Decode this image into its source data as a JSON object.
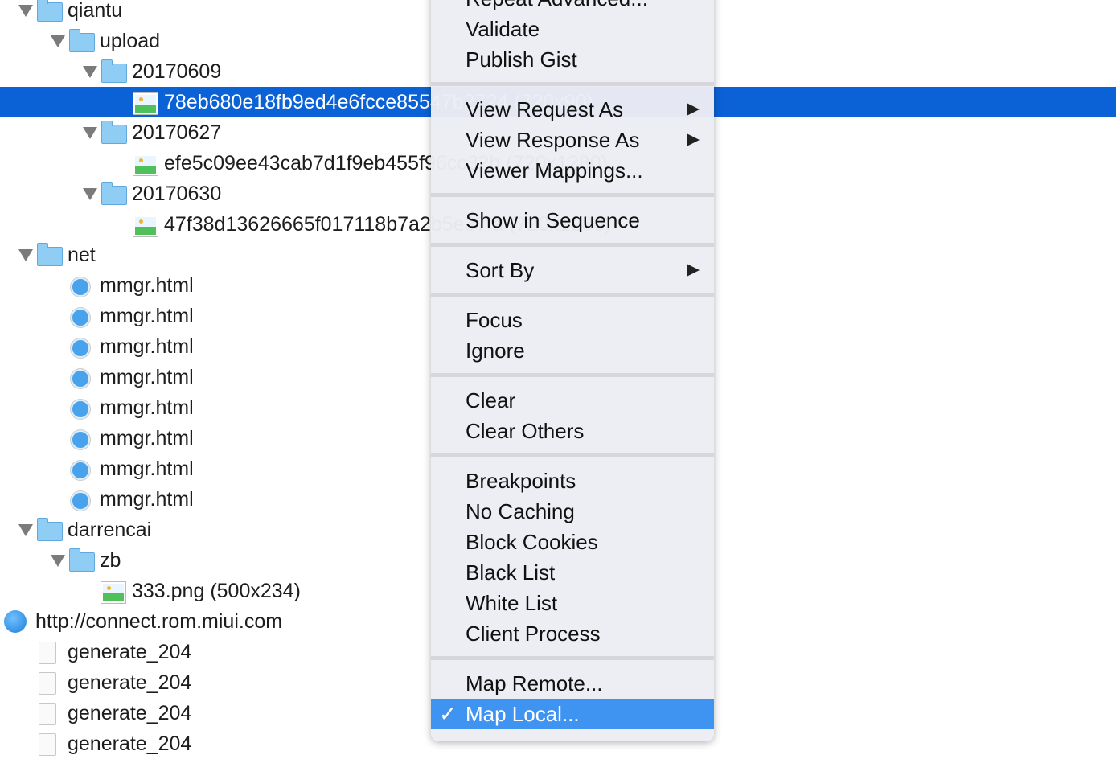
{
  "tree": [
    {
      "label": "qiantu",
      "level": 1,
      "icon": "folder-icon",
      "expanded": true
    },
    {
      "label": "upload",
      "level": 2,
      "icon": "folder-icon",
      "expanded": true
    },
    {
      "label": "20170609",
      "level": 3,
      "icon": "folder-icon",
      "expanded": true
    },
    {
      "label": "78eb680e18fb9ed4e6fcce85547b2724 (720x90)",
      "level": 4,
      "icon": "image-icon",
      "selected": true
    },
    {
      "label": "20170627",
      "level": 3,
      "icon": "folder-icon",
      "expanded": true
    },
    {
      "label": "efe5c09ee43cab7d1f9eb455f96cc32b (720x1280)",
      "level": 4,
      "icon": "image-icon"
    },
    {
      "label": "20170630",
      "level": 3,
      "icon": "folder-icon",
      "expanded": true
    },
    {
      "label": "47f38d13626665f017118b7a2b5e37fa (720x1280)",
      "level": 4,
      "icon": "image-icon"
    },
    {
      "label": "net",
      "level": 1,
      "icon": "folder-icon",
      "expanded": true
    },
    {
      "label": "mmgr.html",
      "level": 2,
      "icon": "html-file-icon"
    },
    {
      "label": "mmgr.html",
      "level": 2,
      "icon": "html-file-icon"
    },
    {
      "label": "mmgr.html",
      "level": 2,
      "icon": "html-file-icon"
    },
    {
      "label": "mmgr.html",
      "level": 2,
      "icon": "html-file-icon"
    },
    {
      "label": "mmgr.html",
      "level": 2,
      "icon": "html-file-icon"
    },
    {
      "label": "mmgr.html",
      "level": 2,
      "icon": "html-file-icon"
    },
    {
      "label": "mmgr.html",
      "level": 2,
      "icon": "html-file-icon"
    },
    {
      "label": "mmgr.html",
      "level": 2,
      "icon": "html-file-icon"
    },
    {
      "label": "darrencai",
      "level": 1,
      "icon": "folder-icon",
      "expanded": true
    },
    {
      "label": "zb",
      "level": 2,
      "icon": "folder-icon",
      "expanded": true
    },
    {
      "label": "333.png (500x234)",
      "level": 3,
      "icon": "image-icon"
    },
    {
      "label": "http://connect.rom.miui.com",
      "level": 0,
      "icon": "globe-icon"
    },
    {
      "label": "generate_204",
      "level": 1,
      "icon": "document-icon"
    },
    {
      "label": "generate_204",
      "level": 1,
      "icon": "document-icon"
    },
    {
      "label": "generate_204",
      "level": 1,
      "icon": "document-icon"
    },
    {
      "label": "generate_204",
      "level": 1,
      "icon": "document-icon"
    }
  ],
  "context_menu": {
    "groups": [
      [
        {
          "label": "Repeat Advanced..."
        },
        {
          "label": "Validate"
        },
        {
          "label": "Publish Gist"
        }
      ],
      [
        {
          "label": "View Request As",
          "submenu": true
        },
        {
          "label": "View Response As",
          "submenu": true
        },
        {
          "label": "Viewer Mappings..."
        }
      ],
      [
        {
          "label": "Show in Sequence"
        }
      ],
      [
        {
          "label": "Sort By",
          "submenu": true
        }
      ],
      [
        {
          "label": "Focus"
        },
        {
          "label": "Ignore"
        }
      ],
      [
        {
          "label": "Clear"
        },
        {
          "label": "Clear Others"
        }
      ],
      [
        {
          "label": "Breakpoints"
        },
        {
          "label": "No Caching"
        },
        {
          "label": "Block Cookies"
        },
        {
          "label": "Black List"
        },
        {
          "label": "White List"
        },
        {
          "label": "Client Process"
        }
      ],
      [
        {
          "label": "Map Remote..."
        },
        {
          "label": "Map Local...",
          "checked": true,
          "highlighted": true
        }
      ]
    ],
    "check_glyph": "✓"
  },
  "colors": {
    "selection": "#0b62d6",
    "menu_highlight": "#3f94f2"
  }
}
